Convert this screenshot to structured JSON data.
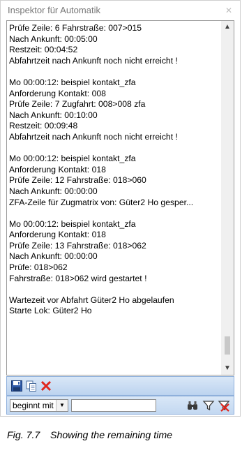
{
  "window": {
    "title": "Inspektor für Automatik"
  },
  "log_lines": [
    "Prüfe Zeile: 6 Fahrstraße: 007>015",
    "Nach Ankunft: 00:05:00",
    "Restzeit: 00:04:52",
    "Abfahrtzeit nach Ankunft noch nicht erreicht !",
    "",
    "Mo 00:00:12: beispiel kontakt_zfa",
    "Anforderung Kontakt: 008",
    "Prüfe Zeile: 7 Zugfahrt: 008>008 zfa",
    "Nach Ankunft: 00:10:00",
    "Restzeit: 00:09:48",
    "Abfahrtzeit nach Ankunft noch nicht erreicht !",
    "",
    "Mo 00:00:12: beispiel kontakt_zfa",
    "Anforderung Kontakt: 018",
    "Prüfe Zeile: 12 Fahrstraße: 018>060",
    "Nach Ankunft: 00:00:00",
    "ZFA-Zeile für Zugmatrix von: Güter2 Ho gesper...",
    "",
    "Mo 00:00:12: beispiel kontakt_zfa",
    "Anforderung Kontakt: 018",
    "Prüfe Zeile: 13 Fahrstraße: 018>062",
    "Nach Ankunft: 00:00:00",
    "Prüfe: 018>062",
    "Fahrstraße: 018>062 wird gestartet !",
    "",
    "Wartezeit vor Abfahrt Güter2 Ho abgelaufen",
    "Starte Lok: Güter2 Ho"
  ],
  "toolbar": {
    "icons": [
      "save-icon",
      "copy-icon",
      "delete-icon"
    ],
    "delete_color": "#e0251b"
  },
  "filter": {
    "mode_value": "beginnt mit",
    "search_value": "",
    "icons": [
      "binoculars-icon",
      "filter-icon",
      "clear-filter-icon"
    ]
  },
  "caption": {
    "number": "Fig. 7.7",
    "text": "Showing the remaining time"
  },
  "colors": {
    "toolbar_blue": "#bcd3ef",
    "title_gray": "#777777"
  }
}
